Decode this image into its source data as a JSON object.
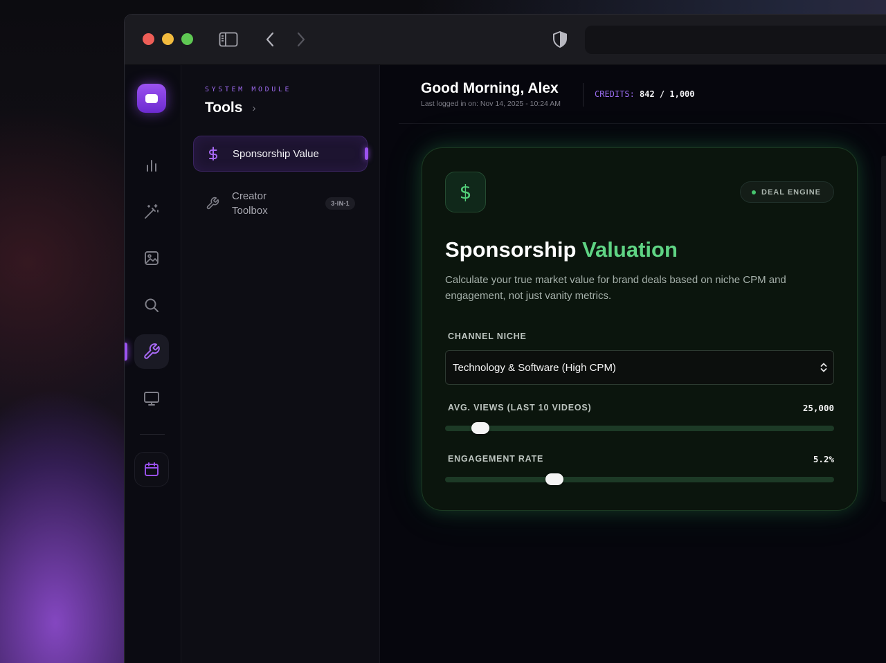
{
  "browser": {
    "icons": [
      "sidebar-toggle-icon",
      "back-arrow-icon",
      "forward-arrow-icon",
      "shield-icon"
    ]
  },
  "rail": {
    "items": [
      {
        "name": "analytics",
        "icon": "bar-chart-icon"
      },
      {
        "name": "magic",
        "icon": "magic-wand-icon"
      },
      {
        "name": "images",
        "icon": "image-icon"
      },
      {
        "name": "search",
        "icon": "search-icon"
      },
      {
        "name": "tools",
        "icon": "wrench-icon",
        "active": true
      },
      {
        "name": "display",
        "icon": "monitor-icon"
      },
      {
        "name": "calendar",
        "icon": "calendar-icon"
      }
    ]
  },
  "module": {
    "kicker": "SYSTEM MODULE",
    "title": "Tools",
    "items": [
      {
        "label": "Sponsorship Value",
        "icon": "dollar-icon",
        "active": true
      },
      {
        "label_line1": "Creator",
        "label_line2": "Toolbox",
        "icon": "wrench-icon",
        "badge": "3-IN-1"
      }
    ]
  },
  "header": {
    "greeting": "Good Morning, Alex",
    "last_login": "Last logged in on: Nov 14, 2025 - 10:24 AM",
    "credits_label": "CREDITS:",
    "credits_value": "842 / 1,000"
  },
  "card": {
    "icon_glyph": "$",
    "badge": "DEAL ENGINE",
    "title_main": "Sponsorship",
    "title_accent": "Valuation",
    "description": "Calculate your true market value for brand deals based on niche CPM and engagement, not just vanity metrics.",
    "niche_label": "CHANNEL NICHE",
    "niche_value": "Technology & Software (High CPM)",
    "views_label": "AVG. VIEWS (LAST 10 VIDEOS)",
    "views_value": "25,000",
    "views_fraction": 0.07,
    "engagement_label": "ENGAGEMENT RATE",
    "engagement_value": "5.2%",
    "engagement_fraction": 0.27
  },
  "colors": {
    "accent_purple": "#9b52f0",
    "accent_green": "#5fd484",
    "window_bg": "#07070d"
  }
}
